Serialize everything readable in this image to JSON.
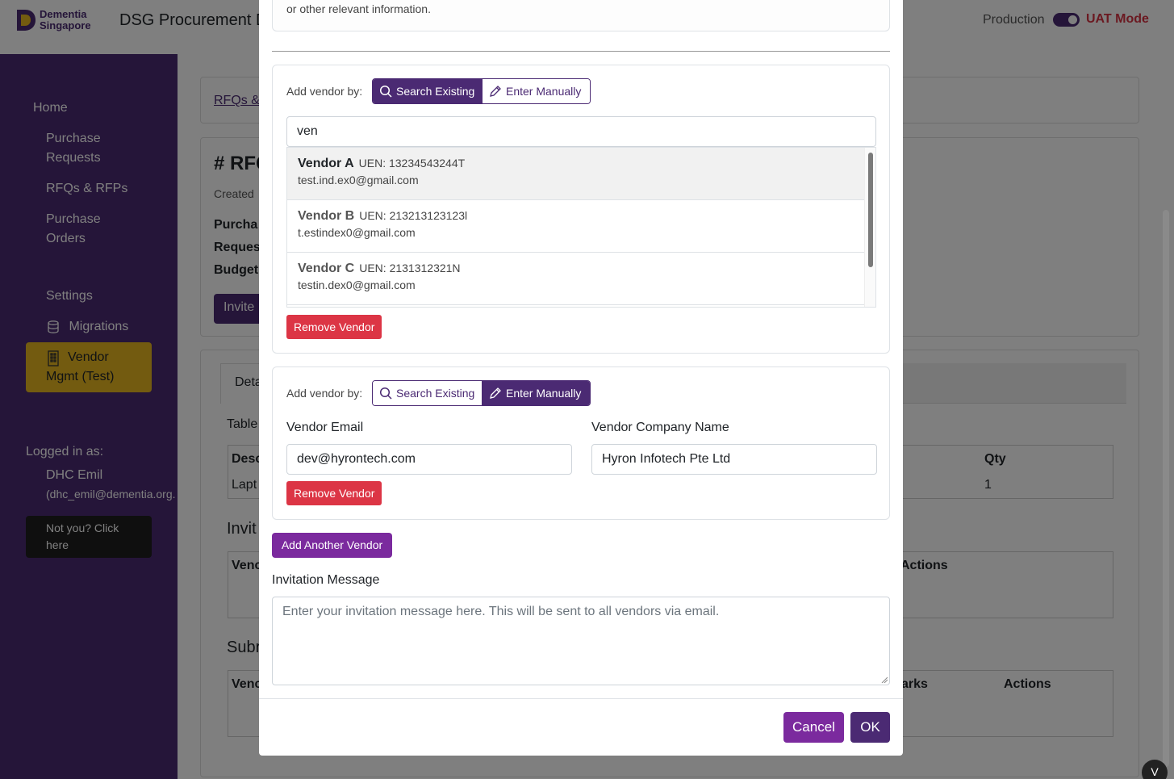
{
  "header": {
    "logo_line1": "Dementia",
    "logo_line2": "Singapore",
    "app_title": "DSG Procurement D",
    "env_label": "Production",
    "env_mode": "UAT Mode"
  },
  "sidebar": {
    "items": [
      {
        "label": "Home"
      },
      {
        "label": "Purchase Requests"
      },
      {
        "label": "RFQs & RFPs"
      },
      {
        "label": "Purchase Orders"
      },
      {
        "label": "Settings"
      },
      {
        "label": "Migrations",
        "icon": "database-icon"
      },
      {
        "label": "Vendor Mgmt (Test)",
        "icon": "building-icon",
        "active": true
      }
    ],
    "logged_in_label": "Logged in as:",
    "user_name": "DHC Emil",
    "user_email": "(dhc_emil@dementia.org.",
    "not_you": "Not you? Click here"
  },
  "background": {
    "breadcrumb": "RFQs &",
    "rfq_title": "# RFQ",
    "created": "Created",
    "row1": "Purcha",
    "row2": "Reques",
    "row3": "Budget",
    "invite_btn": "Invite",
    "tab_details": "Deta",
    "table_label": "Table",
    "col_desc": "Desc",
    "col_qty": "Qty",
    "cell_desc": "Lapt",
    "cell_qty": "1",
    "invites_heading": "Invit",
    "col_vendor": "Venc",
    "col_actions": "Actions",
    "subs_heading": "Subr",
    "col_vendor2": "Venc",
    "col_remarks": "arks",
    "col_actions2": "Actions"
  },
  "modal": {
    "info_text": "or other relevant information.",
    "vendor_block_1": {
      "add_by_label": "Add vendor by:",
      "mode_search": "Search Existing",
      "mode_manual": "Enter Manually",
      "active_mode": "search",
      "search_value": "ven",
      "results": [
        {
          "name": "Vendor A",
          "uen": "UEN: 13234543244T",
          "email": "test.ind.ex0@gmail.com"
        },
        {
          "name": "Vendor B",
          "uen": "UEN: 213213123123l",
          "email": "t.estindex0@gmail.com"
        },
        {
          "name": "Vendor C",
          "uen": "UEN: 2131312321N",
          "email": "testin.dex0@gmail.com"
        }
      ],
      "remove_label": "Remove Vendor"
    },
    "vendor_block_2": {
      "add_by_label": "Add vendor by:",
      "mode_search": "Search Existing",
      "mode_manual": "Enter Manually",
      "active_mode": "manual",
      "email_label": "Vendor Email",
      "email_value": "dev@hyrontech.com",
      "company_label": "Vendor Company Name",
      "company_value": "Hyron Infotech Pte Ltd",
      "remove_label": "Remove Vendor"
    },
    "add_another_label": "Add Another Vendor",
    "message_label": "Invitation Message",
    "message_placeholder": "Enter your invitation message here. This will be sent to all vendors via email.",
    "cancel_label": "Cancel",
    "ok_label": "OK"
  },
  "vue_badge": "V",
  "colors": {
    "brand_purple": "#4b2a73",
    "accent_purple": "#7b2a9e",
    "danger": "#dc3545",
    "active_nav": "#e7b720"
  }
}
